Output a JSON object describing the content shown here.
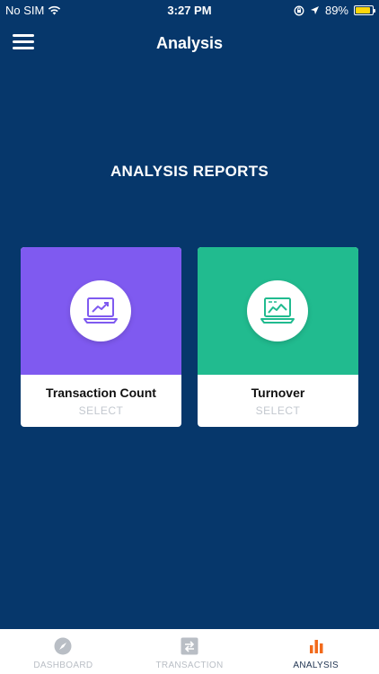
{
  "status_bar": {
    "carrier": "No SIM",
    "time": "3:27 PM",
    "battery": "89%",
    "battery_level": 0.89
  },
  "nav": {
    "title": "Analysis",
    "menu_icon": "hamburger-menu-icon"
  },
  "section_title": "ANALYSIS REPORTS",
  "cards": [
    {
      "label": "Transaction Count",
      "action": "SELECT",
      "color": "#7f5af0",
      "icon": "laptop-trend-chart-icon"
    },
    {
      "label": "Turnover",
      "action": "SELECT",
      "color": "#21bb8f",
      "icon": "laptop-area-chart-icon"
    }
  ],
  "tabs": [
    {
      "label": "DASHBOARD",
      "icon": "compass-icon",
      "active": false
    },
    {
      "label": "TRANSACTION",
      "icon": "swap-arrows-icon",
      "active": false
    },
    {
      "label": "ANALYSIS",
      "icon": "bar-chart-icon",
      "active": true,
      "accent": "#f26a1b"
    }
  ]
}
